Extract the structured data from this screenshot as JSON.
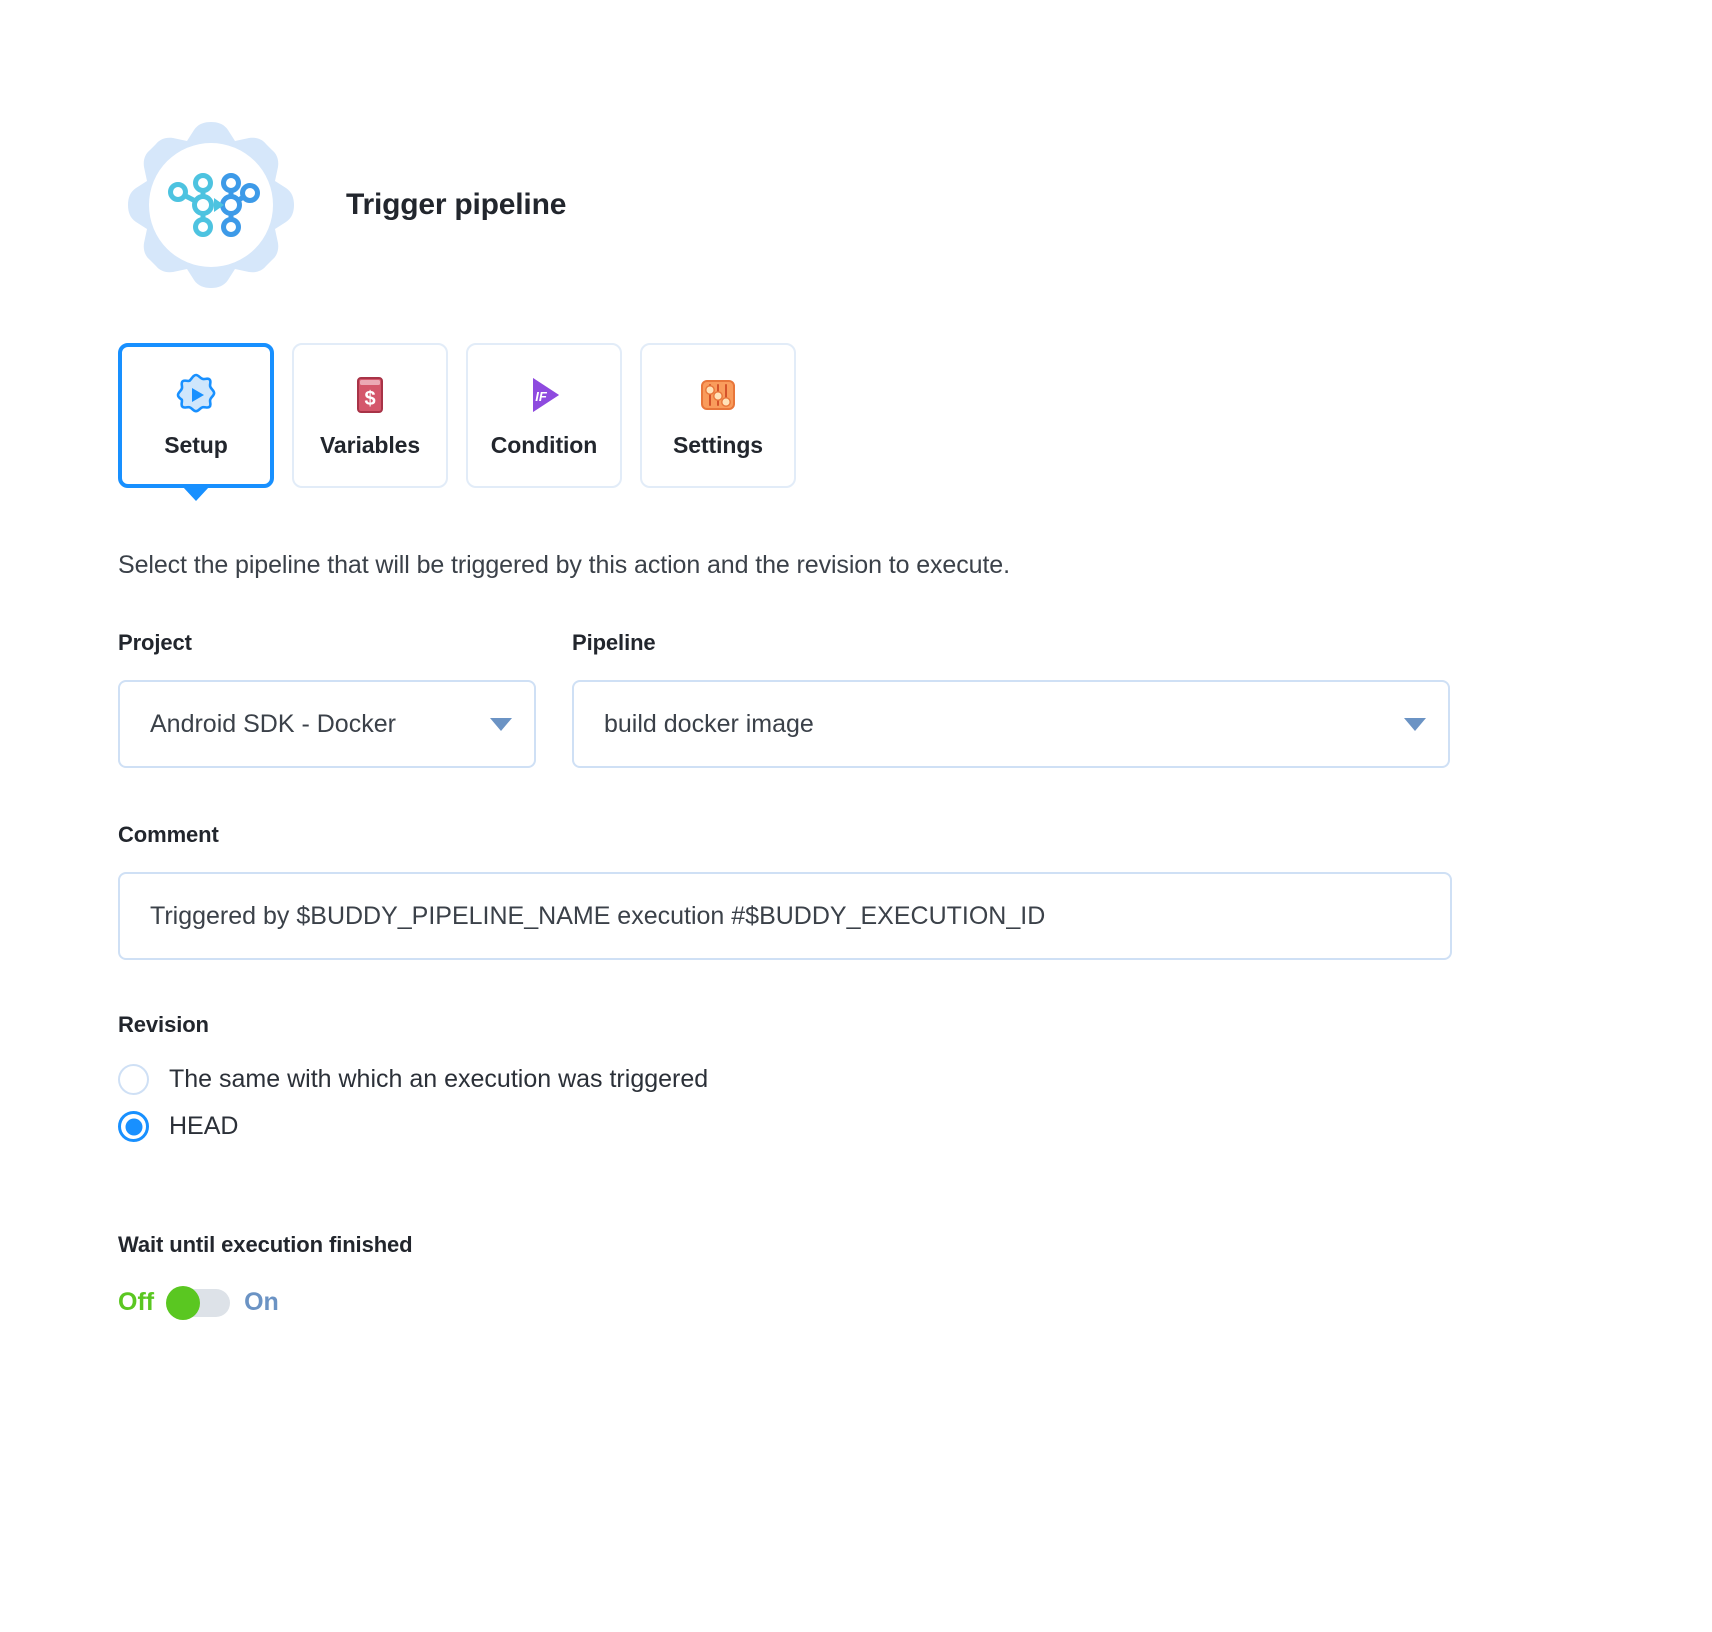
{
  "header": {
    "title": "Trigger pipeline",
    "icon": "trigger-pipeline-gear-icon"
  },
  "tabs": [
    {
      "label": "Setup",
      "icon": "setup-gear-play-icon",
      "active": true
    },
    {
      "label": "Variables",
      "icon": "variables-dollar-icon",
      "active": false
    },
    {
      "label": "Condition",
      "icon": "condition-if-play-icon",
      "active": false
    },
    {
      "label": "Settings",
      "icon": "settings-sliders-icon",
      "active": false
    }
  ],
  "description": "Select the pipeline that will be triggered by this action and the revision to execute.",
  "form": {
    "project": {
      "label": "Project",
      "value": "Android SDK - Docker",
      "caret_icon": "chevron-down-icon"
    },
    "pipeline": {
      "label": "Pipeline",
      "value": "build docker image",
      "caret_icon": "chevron-down-icon"
    },
    "comment": {
      "label": "Comment",
      "value": "Triggered by $BUDDY_PIPELINE_NAME execution #$BUDDY_EXECUTION_ID"
    },
    "revision": {
      "label": "Revision",
      "options": [
        {
          "label": "The same with which an execution was triggered",
          "selected": false
        },
        {
          "label": "HEAD",
          "selected": true
        }
      ]
    },
    "wait_until_finished": {
      "label": "Wait until execution finished",
      "off_label": "Off",
      "on_label": "On",
      "state": "off"
    }
  },
  "colors": {
    "accent_blue": "#1890ff",
    "border_blue": "#cfe0f5",
    "toggle_green": "#5ac721",
    "toggle_on_text": "#6b93c4",
    "text_dark": "#22262d"
  }
}
